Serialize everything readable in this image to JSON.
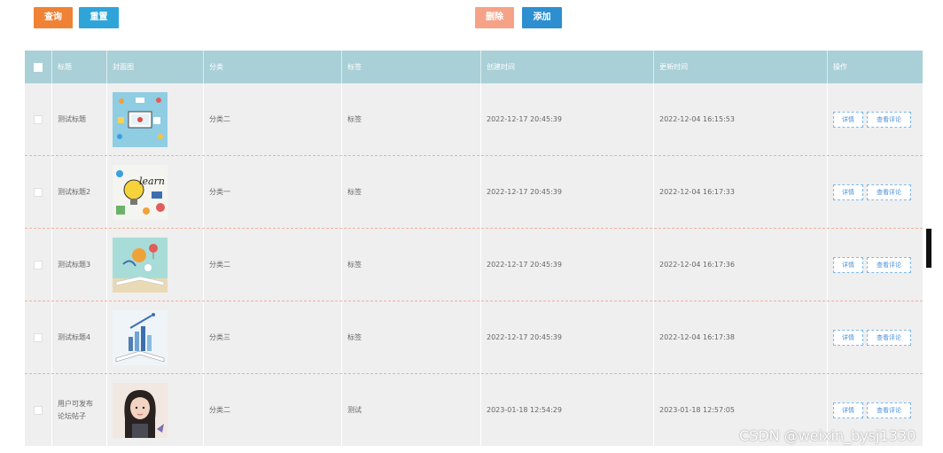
{
  "toolbar": {
    "query_label": "查询",
    "reset_label": "重置",
    "delete_label": "删除",
    "add_label": "添加"
  },
  "table": {
    "headers": [
      "",
      "标题",
      "封面图",
      "分类",
      "标签",
      "创建时间",
      "更新时间",
      "操作"
    ],
    "rows": [
      {
        "title": "测试标题",
        "image": "cover-tech-illustration",
        "category": "分类二",
        "tag": "标签",
        "created": "2022-12-17 20:45:39",
        "updated": "2022-12-04 16:15:53",
        "detail": "详情",
        "comment": "查看评论"
      },
      {
        "title": "测试标题2",
        "image": "cover-learn-lightbulb",
        "category": "分类一",
        "tag": "标签",
        "created": "2022-12-17 20:45:39",
        "updated": "2022-12-04 16:17:33",
        "detail": "详情",
        "comment": "查看评论"
      },
      {
        "title": "测试标题3",
        "image": "cover-book-balloon",
        "category": "分类二",
        "tag": "标签",
        "created": "2022-12-17 20:45:39",
        "updated": "2022-12-04 16:17:36",
        "detail": "详情",
        "comment": "查看评论"
      },
      {
        "title": "测试标题4",
        "image": "cover-open-book-city",
        "category": "分类三",
        "tag": "标签",
        "created": "2022-12-17 20:45:39",
        "updated": "2022-12-04 16:17:38",
        "detail": "详情",
        "comment": "查看评论"
      },
      {
        "title": "用户可发布\n论坛帖子",
        "image": "cover-portrait-girl",
        "category": "分类二",
        "tag": "测试",
        "created": "2023-01-18 12:54:29",
        "updated": "2023-01-18 12:57:05",
        "detail": "详情",
        "comment": "查看评论"
      }
    ]
  },
  "watermark": "CSDN @weixin_bysj1330"
}
